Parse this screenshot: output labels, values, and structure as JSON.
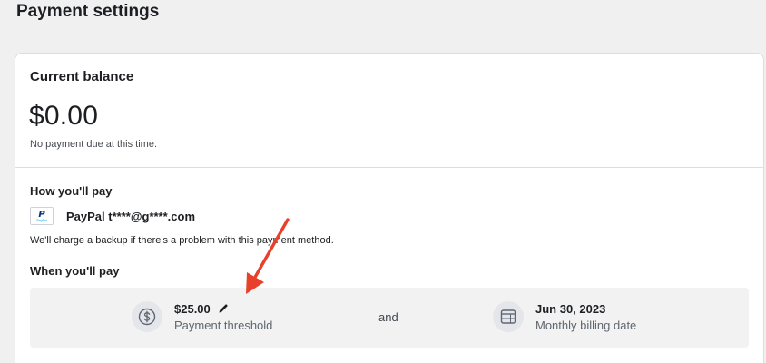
{
  "page": {
    "title": "Payment settings"
  },
  "balance": {
    "label": "Current balance",
    "amount": "$0.00",
    "note": "No payment due at this time."
  },
  "how_you_pay": {
    "label": "How you'll pay",
    "method_name": "PayPal t****@g****.com",
    "logo_mark": "P",
    "logo_text": "PayPal",
    "backup_note": "We'll charge a backup if there's a problem with this payment method."
  },
  "when_you_pay": {
    "label": "When you'll pay",
    "threshold": {
      "value": "$25.00",
      "caption": "Payment threshold",
      "icon": "dollar-circle-icon"
    },
    "connector": "and",
    "billing": {
      "value": "Jun 30, 2023",
      "caption": "Monthly billing date",
      "icon": "calendar-icon"
    }
  },
  "colors": {
    "background": "#f0f0f0",
    "card": "#ffffff",
    "annotation_arrow": "#e8402a"
  }
}
